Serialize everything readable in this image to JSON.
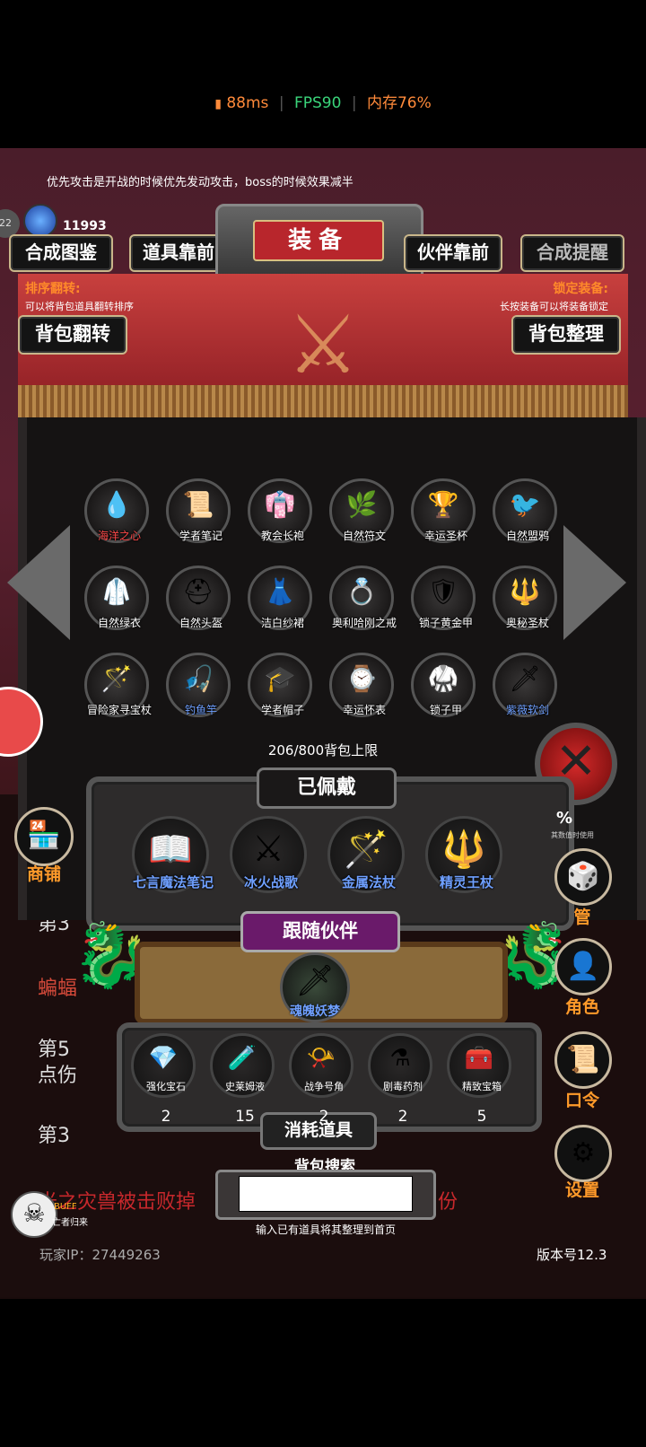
{
  "status": {
    "ping": "88ms",
    "fps": "FPS90",
    "memory": "内存76%"
  },
  "tip": "优先攻击是开战的时候优先发动攻击，boss的时候效果减半",
  "player": {
    "level": "22",
    "gems": "11993"
  },
  "tabs": {
    "synthesis_guide": "合成图鉴",
    "items_front": "道具靠前",
    "equip": "装备",
    "partner_front": "伙伴靠前",
    "synthesis_remind": "合成提醒"
  },
  "sort": {
    "title": "排序翻转:",
    "desc": "可以将背包道具翻转排序",
    "button": "背包翻转"
  },
  "lock": {
    "title": "锁定装备:",
    "desc": "长按装备可以将装备锁定",
    "button": "背包整理"
  },
  "inventory": [
    {
      "name": "海洋之心",
      "icon": "💧",
      "color": "#ff4a4a"
    },
    {
      "name": "学者笔记",
      "icon": "📜",
      "color": "#ffffff"
    },
    {
      "name": "教会长袍",
      "icon": "👘",
      "color": "#ffffff"
    },
    {
      "name": "自然符文",
      "icon": "🌿",
      "color": "#ffffff"
    },
    {
      "name": "幸运圣杯",
      "icon": "🏆",
      "color": "#ffffff"
    },
    {
      "name": "自然盟鸦",
      "icon": "🐦",
      "color": "#ffffff"
    },
    {
      "name": "自然绿衣",
      "icon": "🥼",
      "color": "#ffffff"
    },
    {
      "name": "自然头盔",
      "icon": "⛑",
      "color": "#ffffff"
    },
    {
      "name": "洁白纱裙",
      "icon": "👗",
      "color": "#ffffff"
    },
    {
      "name": "奥利哈刚之戒",
      "icon": "💍",
      "color": "#ffffff"
    },
    {
      "name": "锁子黄金甲",
      "icon": "🛡",
      "color": "#ffffff"
    },
    {
      "name": "奥秘圣杖",
      "icon": "🔱",
      "color": "#ffffff"
    },
    {
      "name": "冒险家寻宝杖",
      "icon": "🪄",
      "color": "#ffffff"
    },
    {
      "name": "钓鱼竿",
      "icon": "🎣",
      "color": "#6fa0ff"
    },
    {
      "name": "学者帽子",
      "icon": "🎓",
      "color": "#ffffff"
    },
    {
      "name": "幸运怀表",
      "icon": "⌚",
      "color": "#ffffff"
    },
    {
      "name": "锁子甲",
      "icon": "🥋",
      "color": "#ffffff"
    },
    {
      "name": "紫薇软剑",
      "icon": "🗡",
      "color": "#6fa0ff"
    }
  ],
  "capacity": "206/800背包上限",
  "equipped": {
    "title": "已佩戴",
    "items": [
      {
        "name": "七言魔法笔记",
        "icon": "📖"
      },
      {
        "name": "冰火战歌",
        "icon": "⚔"
      },
      {
        "name": "金属法杖",
        "icon": "🪄"
      },
      {
        "name": "精灵王杖",
        "icon": "🔱"
      }
    ]
  },
  "partner": {
    "title": "跟随伙伴",
    "name": "魂魄妖梦",
    "icon": "🗡"
  },
  "consumables": {
    "title": "消耗道具",
    "items": [
      {
        "name": "强化宝石",
        "icon": "💎",
        "count": "2"
      },
      {
        "name": "史莱姆液",
        "icon": "🧪",
        "count": "15"
      },
      {
        "name": "战争号角",
        "icon": "📯",
        "count": "2"
      },
      {
        "name": "剧毒药剂",
        "icon": "⚗",
        "count": "2"
      },
      {
        "name": "精致宝箱",
        "icon": "🧰",
        "count": "5"
      }
    ]
  },
  "search": {
    "title": "背包搜索",
    "hint": "输入已有道具将其整理到首页",
    "value": ""
  },
  "side": {
    "shop": "商铺",
    "manage": "管",
    "role": "角色",
    "command": "口令",
    "settings": "设置",
    "percent": "%",
    "percent_note": "其数值时使用"
  },
  "bg_text": {
    "line1": "第3",
    "line2": "蝙蝠",
    "line3": "第5",
    "line4": "点伤",
    "line5": "第3",
    "line6": "光之灾兽被击败掉",
    "line7": "份"
  },
  "buff": {
    "label": "BUFF",
    "sub": "亡者归来"
  },
  "footer": {
    "player_ip": "玩家IP：27449263",
    "version": "版本号12.3"
  },
  "colors": {
    "accent_gold": "#c9b68a",
    "ping_orange": "#ff8a3a",
    "fps_green": "#3ad47a",
    "mem_orange": "#ff8a3a",
    "side_label": "#ff9a2a"
  }
}
